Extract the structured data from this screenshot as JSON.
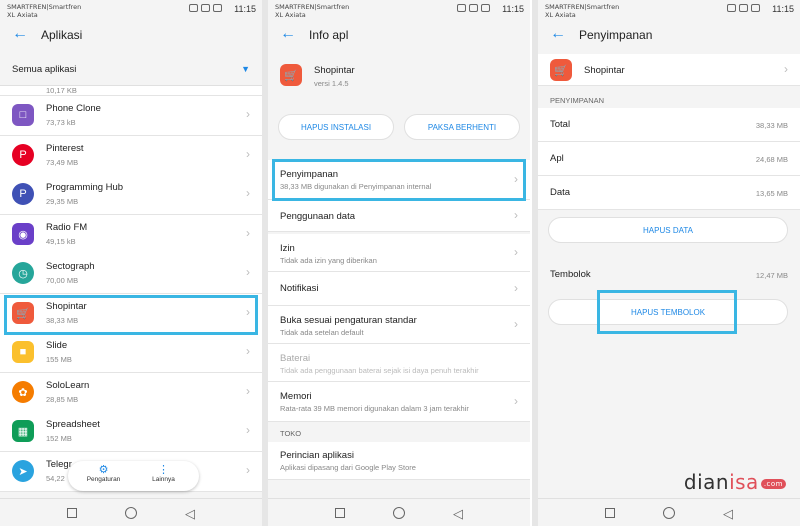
{
  "status": {
    "carrier1": "SMARTFREN|Smartfren",
    "carrier2": "XL Axiata",
    "time": "11:15"
  },
  "panel1": {
    "title": "Aplikasi",
    "filter": "Semua aplikasi",
    "partial_size": "10,17 KB",
    "apps": [
      {
        "name": "Phone Clone",
        "size": "73,73 kB",
        "color": "#7e57c2",
        "icon": "phone-clone-icon"
      },
      {
        "name": "Pinterest",
        "size": "73,49 MB",
        "color": "#e60023",
        "icon": "pinterest-icon"
      },
      {
        "name": "Programming Hub",
        "size": "29,35 MB",
        "color": "#3f51b5",
        "icon": "programming-hub-icon"
      },
      {
        "name": "Radio FM",
        "size": "49,15 kB",
        "color": "#6a3fc8",
        "icon": "radio-fm-icon"
      },
      {
        "name": "Sectograph",
        "size": "70,00 MB",
        "color": "#26a69a",
        "icon": "sectograph-icon"
      },
      {
        "name": "Shopintar",
        "size": "38,33 MB",
        "color": "#ef5a3c",
        "icon": "shopintar-icon"
      },
      {
        "name": "Slide",
        "size": "155 MB",
        "color": "#fbc02d",
        "icon": "slide-icon"
      },
      {
        "name": "SoloLearn",
        "size": "28,85 MB",
        "color": "#f57c00",
        "icon": "sololearn-icon"
      },
      {
        "name": "Spreadsheet",
        "size": "152 MB",
        "color": "#0f9d58",
        "icon": "spreadsheet-icon"
      },
      {
        "name": "Telegr",
        "size": "54,22",
        "color": "#2aa3df",
        "icon": "telegram-icon"
      }
    ],
    "fab_settings": "Pengaturan",
    "fab_more": "Lainnya"
  },
  "panel2": {
    "title": "Info apl",
    "app_name": "Shopintar",
    "app_version": "versi 1.4.5",
    "btn_uninstall": "HAPUS INSTALASI",
    "btn_force_stop": "PAKSA BERHENTI",
    "rows": [
      {
        "title": "Penyimpanan",
        "sub": "38,33 MB digunakan di Penyimpanan internal"
      },
      {
        "title": "Penggunaan data",
        "sub": ""
      },
      {
        "title": "Izin",
        "sub": "Tidak ada izin yang diberikan"
      },
      {
        "title": "Notifikasi",
        "sub": ""
      },
      {
        "title": "Buka sesuai pengaturan standar",
        "sub": "Tidak ada setelan default"
      },
      {
        "title": "Baterai",
        "sub": "Tidak ada penggunaan baterai sejak isi daya penuh terakhir"
      },
      {
        "title": "Memori",
        "sub": "Rata-rata 39 MB memori digunakan dalam 3 jam terakhir"
      }
    ],
    "section_toko": "TOKO",
    "store_title": "Perincian aplikasi",
    "store_sub": "Aplikasi dipasang dari Google Play Store"
  },
  "panel3": {
    "title": "Penyimpanan",
    "app_name": "Shopintar",
    "section": "PENYIMPANAN",
    "total_label": "Total",
    "total_value": "38,33 MB",
    "apl_label": "Apl",
    "apl_value": "24,68 MB",
    "data_label": "Data",
    "data_value": "13,65 MB",
    "btn_clear_data": "HAPUS DATA",
    "cache_label": "Tembolok",
    "cache_value": "12,47 MB",
    "btn_clear_cache": "HAPUS TEMBOLOK"
  },
  "watermark": {
    "text1": "dian",
    "text2": "isa",
    "suffix": ".com"
  },
  "colors": {
    "accent": "#1e88e5",
    "highlight": "#3ab6e3"
  }
}
